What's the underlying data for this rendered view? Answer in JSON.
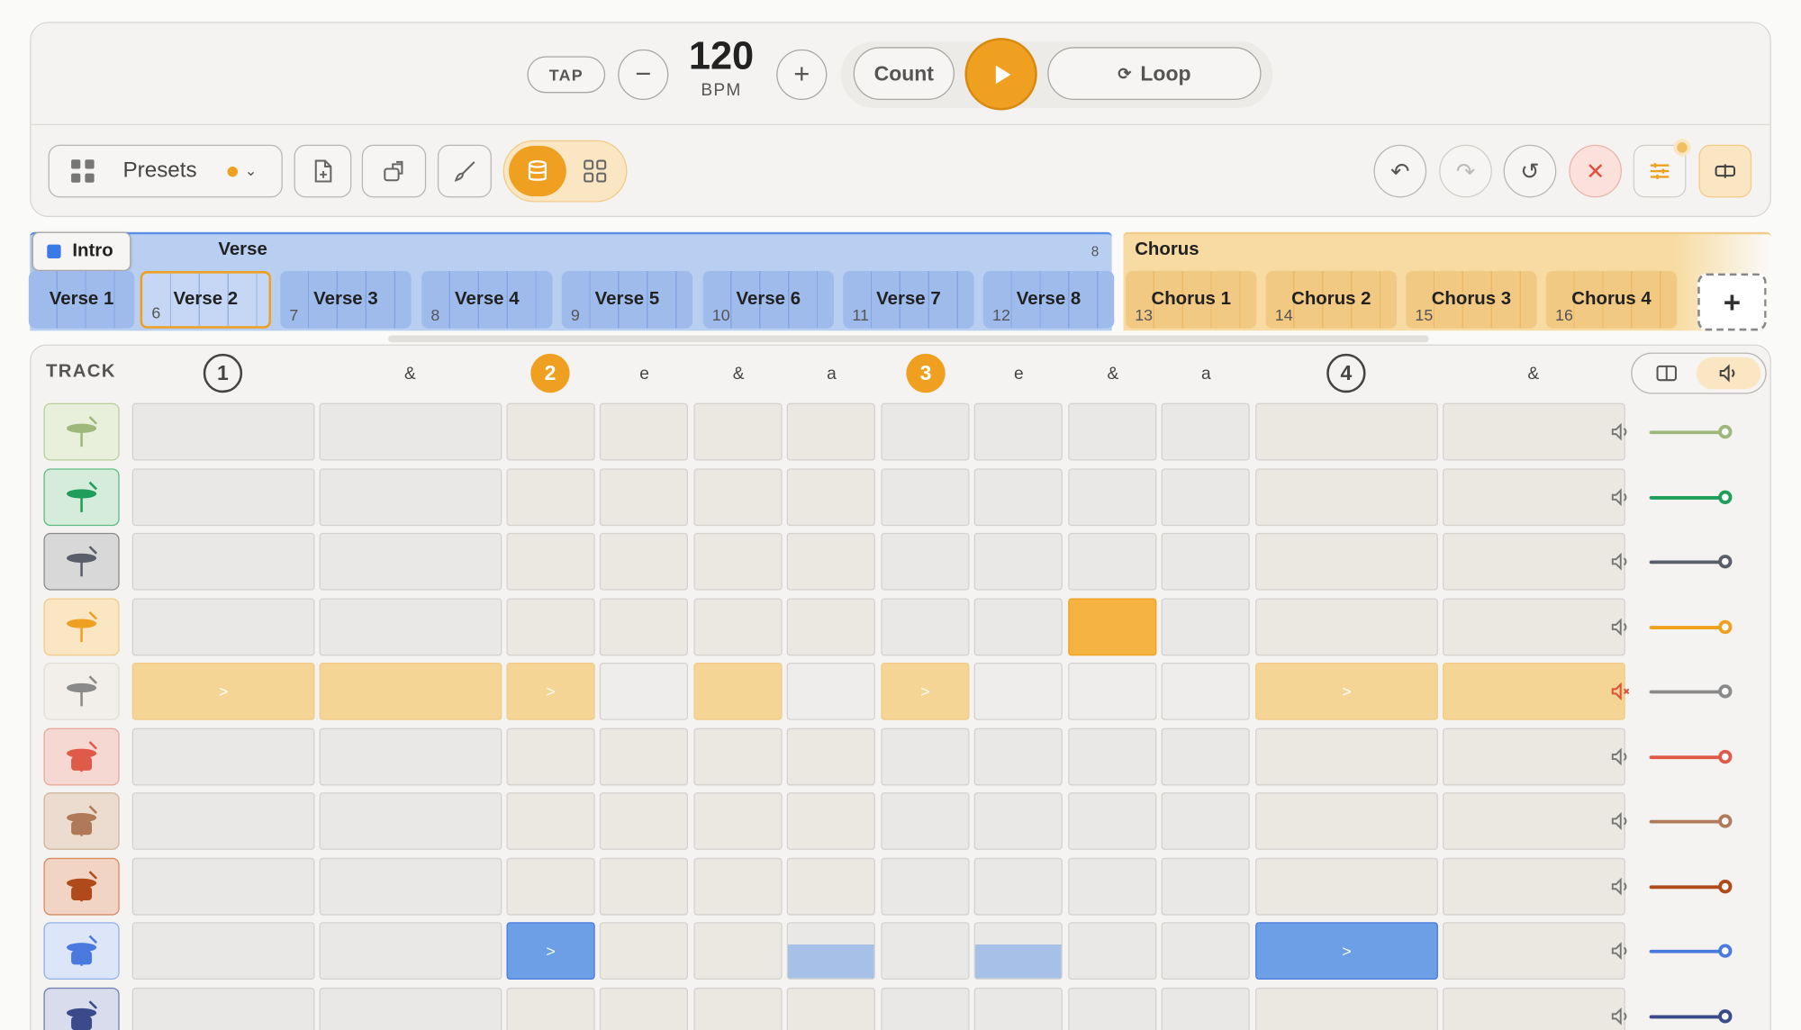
{
  "transport": {
    "tap": "TAP",
    "minus": "−",
    "plus": "+",
    "bpm_value": "120",
    "bpm_unit": "BPM",
    "count": "Count",
    "loop": "Loop"
  },
  "toolbar": {
    "presets": "Presets"
  },
  "sections": {
    "intro": "Intro",
    "verse": {
      "label": "Verse",
      "count": "8"
    },
    "chorus": {
      "label": "Chorus"
    }
  },
  "subsections": [
    {
      "label": "Verse 1",
      "num": ""
    },
    {
      "label": "Verse 2",
      "num": "6"
    },
    {
      "label": "Verse 3",
      "num": "7"
    },
    {
      "label": "Verse 4",
      "num": "8"
    },
    {
      "label": "Verse 5",
      "num": "9"
    },
    {
      "label": "Verse 6",
      "num": "10"
    },
    {
      "label": "Verse 7",
      "num": "11"
    },
    {
      "label": "Verse 8",
      "num": "12"
    },
    {
      "label": "Chorus 1",
      "num": "13"
    },
    {
      "label": "Chorus 2",
      "num": "14"
    },
    {
      "label": "Chorus 3",
      "num": "15"
    },
    {
      "label": "Chorus 4",
      "num": "16"
    }
  ],
  "add_section": "+",
  "grid": {
    "track_header": "TRACK",
    "beats": [
      "1",
      "&",
      "2",
      "e",
      "&",
      "a",
      "3",
      "e",
      "&",
      "a",
      "4",
      "&"
    ],
    "accent": ">",
    "tracks": [
      {
        "icon": "cymbal-crash-icon",
        "color": "#9db87a",
        "level": 1.0,
        "muted": false
      },
      {
        "icon": "cymbal-ride-icon",
        "color": "#1e9e5a",
        "level": 1.0,
        "muted": false
      },
      {
        "icon": "cowbell-icon",
        "color": "#5a5e6a",
        "level": 1.0,
        "muted": false
      },
      {
        "icon": "hihat-icon",
        "color": "#f0a020",
        "level": 1.0,
        "muted": false
      },
      {
        "icon": "hihat-open-icon",
        "color": "#8a8a8a",
        "level": 1.0,
        "muted": true
      },
      {
        "icon": "snare-icon",
        "color": "#e05a4a",
        "level": 1.0,
        "muted": false
      },
      {
        "icon": "tom-icon",
        "color": "#b07a5a",
        "level": 1.0,
        "muted": false
      },
      {
        "icon": "floor-tom-icon",
        "color": "#b04a1a",
        "level": 1.0,
        "muted": false
      },
      {
        "icon": "bass-drum-icon",
        "color": "#4a7ae0",
        "level": 1.0,
        "muted": false
      },
      {
        "icon": "bass-drum-2-icon",
        "color": "#3a4a8a",
        "level": 1.0,
        "muted": false
      }
    ]
  }
}
